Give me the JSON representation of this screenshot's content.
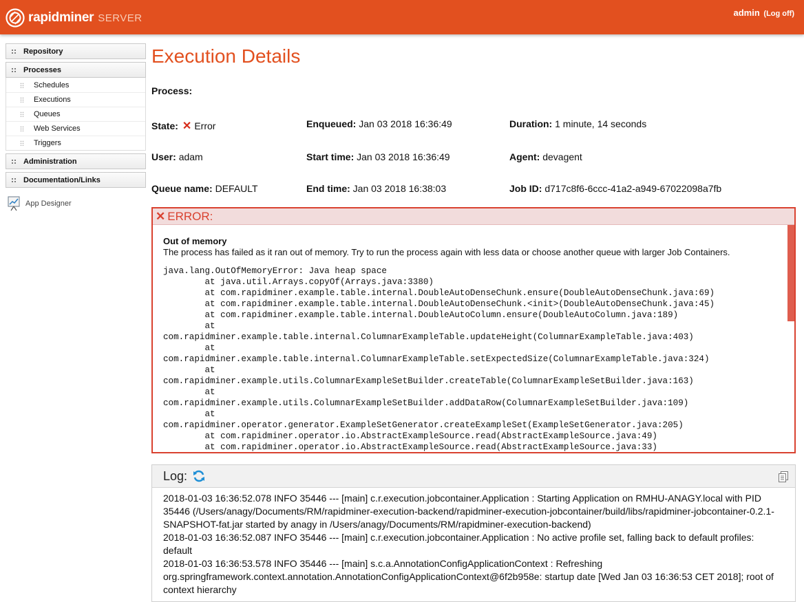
{
  "header": {
    "brand": "rapidminer",
    "brand_sub": "SERVER",
    "user": "admin",
    "logoff": "(Log off)"
  },
  "sidebar": {
    "sections": [
      {
        "label": "Repository"
      },
      {
        "label": "Processes",
        "items": [
          "Schedules",
          "Executions",
          "Queues",
          "Web Services",
          "Triggers"
        ]
      },
      {
        "label": "Administration"
      },
      {
        "label": "Documentation/Links"
      }
    ],
    "app_designer": "App Designer"
  },
  "page": {
    "title": "Execution Details",
    "process_label": "Process:",
    "process_value": "",
    "state_label": "State:",
    "state_value": "Error",
    "enqueued_label": "Enqueued:",
    "enqueued_value": "Jan 03 2018 16:36:49",
    "duration_label": "Duration:",
    "duration_value": "1 minute, 14 seconds",
    "user_label": "User:",
    "user_value": "adam",
    "start_label": "Start time:",
    "start_value": "Jan 03 2018 16:36:49",
    "agent_label": "Agent:",
    "agent_value": "devagent",
    "queue_label": "Queue name:",
    "queue_value": "DEFAULT",
    "end_label": "End time:",
    "end_value": "Jan 03 2018 16:38:03",
    "jobid_label": "Job ID:",
    "jobid_value": "d717c8f6-6ccc-41a2-a949-67022098a7fb"
  },
  "error": {
    "heading": "ERROR:",
    "title": "Out of memory",
    "description": "The process has failed as it ran out of memory. Try to run the process again with less data or choose another queue with larger Job Containers.",
    "stacktrace": [
      "java.lang.OutOfMemoryError: Java heap space",
      "        at java.util.Arrays.copyOf(Arrays.java:3380)",
      "        at com.rapidminer.example.table.internal.DoubleAutoDenseChunk.ensure(DoubleAutoDenseChunk.java:69)",
      "        at com.rapidminer.example.table.internal.DoubleAutoDenseChunk.<init>(DoubleAutoDenseChunk.java:45)",
      "        at com.rapidminer.example.table.internal.DoubleAutoColumn.ensure(DoubleAutoColumn.java:189)",
      "        at",
      "com.rapidminer.example.table.internal.ColumnarExampleTable.updateHeight(ColumnarExampleTable.java:403)",
      "        at",
      "com.rapidminer.example.table.internal.ColumnarExampleTable.setExpectedSize(ColumnarExampleTable.java:324)",
      "        at",
      "com.rapidminer.example.utils.ColumnarExampleSetBuilder.createTable(ColumnarExampleSetBuilder.java:163)",
      "        at",
      "com.rapidminer.example.utils.ColumnarExampleSetBuilder.addDataRow(ColumnarExampleSetBuilder.java:109)",
      "        at",
      "com.rapidminer.operator.generator.ExampleSetGenerator.createExampleSet(ExampleSetGenerator.java:205)",
      "        at com.rapidminer.operator.io.AbstractExampleSource.read(AbstractExampleSource.java:49)",
      "        at com.rapidminer.operator.io.AbstractExampleSource.read(AbstractExampleSource.java:33)"
    ]
  },
  "log": {
    "heading": "Log:",
    "lines": [
      "2018-01-03 16:36:52.078  INFO 35446 --- [main] c.r.execution.jobcontainer.Application   : Starting Application on RMHU-ANAGY.local with PID 35446 (/Users/anagy/Documents/RM/rapidminer-execution-backend/rapidminer-execution-jobcontainer/build/libs/rapidminer-jobcontainer-0.2.1-SNAPSHOT-fat.jar started by anagy in /Users/anagy/Documents/RM/rapidminer-execution-backend)",
      "2018-01-03 16:36:52.087  INFO 35446 --- [main] c.r.execution.jobcontainer.Application   : No active profile set, falling back to default profiles: default",
      "2018-01-03 16:36:53.578  INFO 35446 --- [main] s.c.a.AnnotationConfigApplicationContext : Refreshing org.springframework.context.annotation.AnnotationConfigApplicationContext@6f2b958e: startup date [Wed Jan 03 16:36:53 CET 2018]; root of context hierarchy"
    ]
  },
  "colors": {
    "brand": "#e2501f",
    "error": "#d9412f",
    "error_bg": "#f2dcdc",
    "refresh": "#1f8fd6"
  }
}
